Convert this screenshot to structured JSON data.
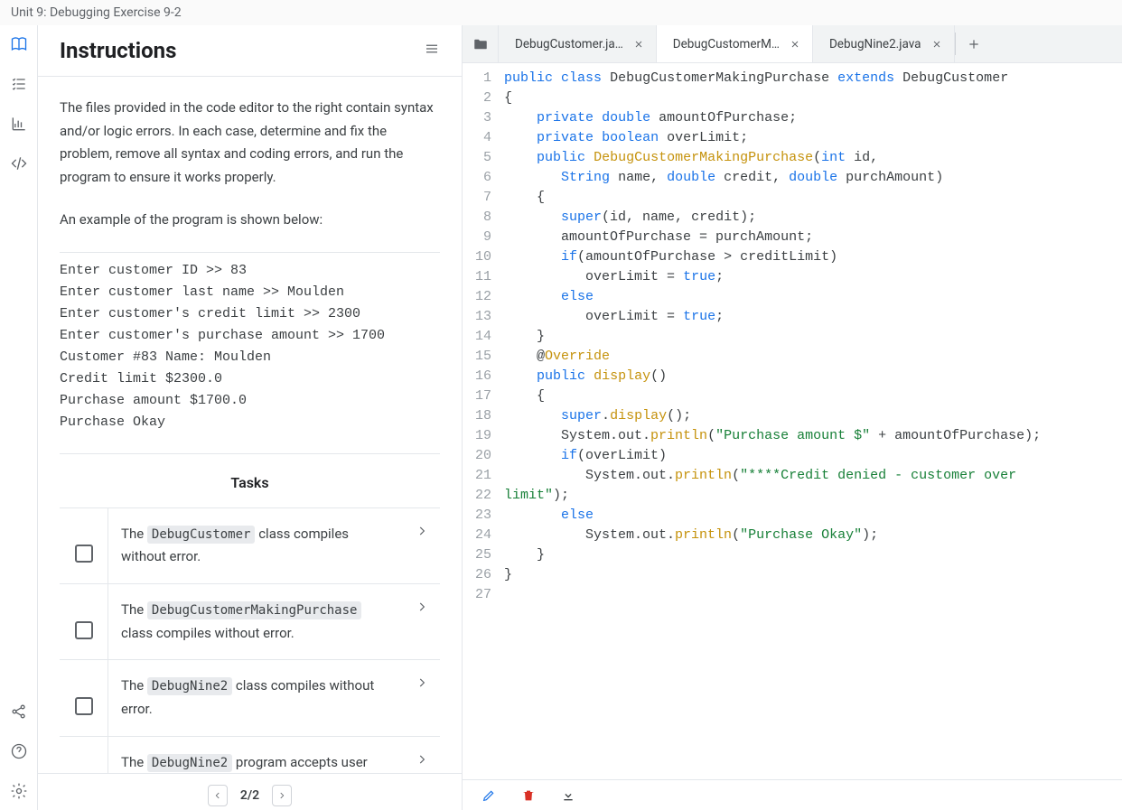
{
  "titleBar": "Unit 9: Debugging Exercise 9-2",
  "instructions": {
    "heading": "Instructions",
    "paragraph": "The files provided in the code editor to the right contain syntax and/or logic errors. In each case, determine and fix the problem, remove all syntax and coding errors, and run the program to ensure it works properly.",
    "exampleIntro": "An example of the program is shown below:",
    "exampleOutput": "Enter customer ID >> 83\nEnter customer last name >> Moulden\nEnter customer's credit limit >> 2300\nEnter customer's purchase amount >> 1700\nCustomer #83 Name: Moulden\nCredit limit $2300.0\nPurchase amount $1700.0\nPurchase Okay",
    "tasksHeading": "Tasks",
    "tasks": [
      {
        "pre": "The ",
        "code": "DebugCustomer",
        "post": " class compiles without error."
      },
      {
        "pre": "The ",
        "code": "DebugCustomerMakingPurchase",
        "post": " class compiles without error."
      },
      {
        "pre": "The ",
        "code": "DebugNine2",
        "post": " class compiles without error."
      },
      {
        "pre": "The ",
        "code": "DebugNine2",
        "post": " program accepts user input and displays the correct output."
      }
    ],
    "pager": {
      "current": "2/2"
    }
  },
  "tabs": [
    {
      "label": "DebugCustomer.ja…",
      "active": false
    },
    {
      "label": "DebugCustomerM…",
      "active": true
    },
    {
      "label": "DebugNine2.java",
      "active": false
    }
  ],
  "code": {
    "lines": [
      [
        [
          "public",
          "kw"
        ],
        [
          " ",
          "punc"
        ],
        [
          "class",
          "kw"
        ],
        [
          " ",
          "punc"
        ],
        [
          "DebugCustomerMakingPurchase",
          "var"
        ],
        [
          " ",
          "punc"
        ],
        [
          "extends",
          "kw"
        ],
        [
          " ",
          "punc"
        ],
        [
          "DebugCustomer",
          "var"
        ]
      ],
      [
        [
          "{",
          "punc"
        ]
      ],
      [
        [
          "    ",
          "punc"
        ],
        [
          "private",
          "kw"
        ],
        [
          " ",
          "punc"
        ],
        [
          "double",
          "type"
        ],
        [
          " ",
          "punc"
        ],
        [
          "amountOfPurchase;",
          "var"
        ]
      ],
      [
        [
          "    ",
          "punc"
        ],
        [
          "private",
          "kw"
        ],
        [
          " ",
          "punc"
        ],
        [
          "boolean",
          "type"
        ],
        [
          " ",
          "punc"
        ],
        [
          "overLimit;",
          "var"
        ]
      ],
      [
        [
          "    ",
          "punc"
        ],
        [
          "public",
          "kw"
        ],
        [
          " ",
          "punc"
        ],
        [
          "DebugCustomerMakingPurchase",
          "fn"
        ],
        [
          "(",
          "punc"
        ],
        [
          "int",
          "type"
        ],
        [
          " ",
          "punc"
        ],
        [
          "id,",
          "var"
        ]
      ],
      [
        [
          "       ",
          "punc"
        ],
        [
          "String",
          "type"
        ],
        [
          " ",
          "punc"
        ],
        [
          "name, ",
          "var"
        ],
        [
          "double",
          "type"
        ],
        [
          " ",
          "punc"
        ],
        [
          "credit, ",
          "var"
        ],
        [
          "double",
          "type"
        ],
        [
          " ",
          "punc"
        ],
        [
          "purchAmount",
          "var"
        ],
        [
          ")",
          "punc"
        ]
      ],
      [
        [
          "    {",
          "punc"
        ]
      ],
      [
        [
          "       ",
          "punc"
        ],
        [
          "super",
          "kw"
        ],
        [
          "(id, name, credit);",
          "var"
        ]
      ],
      [
        [
          "       amountOfPurchase = purchAmount;",
          "var"
        ]
      ],
      [
        [
          "       ",
          "punc"
        ],
        [
          "if",
          "kw"
        ],
        [
          "(amountOfPurchase > creditLimit)",
          "var"
        ]
      ],
      [
        [
          "          overLimit = ",
          "var"
        ],
        [
          "true",
          "bool"
        ],
        [
          ";",
          "punc"
        ]
      ],
      [
        [
          "       ",
          "punc"
        ],
        [
          "else",
          "kw"
        ]
      ],
      [
        [
          "          overLimit = ",
          "var"
        ],
        [
          "true",
          "bool"
        ],
        [
          ";",
          "punc"
        ]
      ],
      [
        [
          "    }",
          "punc"
        ]
      ],
      [
        [
          "    @",
          "punc"
        ],
        [
          "Override",
          "ann"
        ]
      ],
      [
        [
          "    ",
          "punc"
        ],
        [
          "public",
          "kw"
        ],
        [
          " ",
          "punc"
        ],
        [
          "display",
          "fn"
        ],
        [
          "()",
          "punc"
        ]
      ],
      [
        [
          "    {",
          "punc"
        ]
      ],
      [
        [
          "       ",
          "punc"
        ],
        [
          "super",
          "kw"
        ],
        [
          ".",
          "punc"
        ],
        [
          "display",
          "fn"
        ],
        [
          "();",
          "punc"
        ]
      ],
      [
        [
          "       System.out.",
          "var"
        ],
        [
          "println",
          "fn"
        ],
        [
          "(",
          "punc"
        ],
        [
          "\"Purchase amount $\"",
          "str"
        ],
        [
          " + amountOfPurchase);",
          "var"
        ]
      ],
      [
        [
          "       ",
          "punc"
        ],
        [
          "if",
          "kw"
        ],
        [
          "(overLimit)",
          "var"
        ]
      ],
      [
        [
          "          System.out.",
          "var"
        ],
        [
          "println",
          "fn"
        ],
        [
          "(",
          "punc"
        ],
        [
          "\"****Credit denied - customer over ",
          "str"
        ]
      ],
      [
        [
          "limit\"",
          "str"
        ],
        [
          ");",
          "punc"
        ]
      ],
      [
        [
          "       ",
          "punc"
        ],
        [
          "else",
          "kw"
        ]
      ],
      [
        [
          "          System.out.",
          "var"
        ],
        [
          "println",
          "fn"
        ],
        [
          "(",
          "punc"
        ],
        [
          "\"Purchase Okay\"",
          "str"
        ],
        [
          ");",
          "punc"
        ]
      ],
      [
        [
          "    }",
          "punc"
        ]
      ],
      [
        [
          "}",
          "punc"
        ]
      ],
      [
        [
          "",
          "punc"
        ]
      ]
    ]
  }
}
